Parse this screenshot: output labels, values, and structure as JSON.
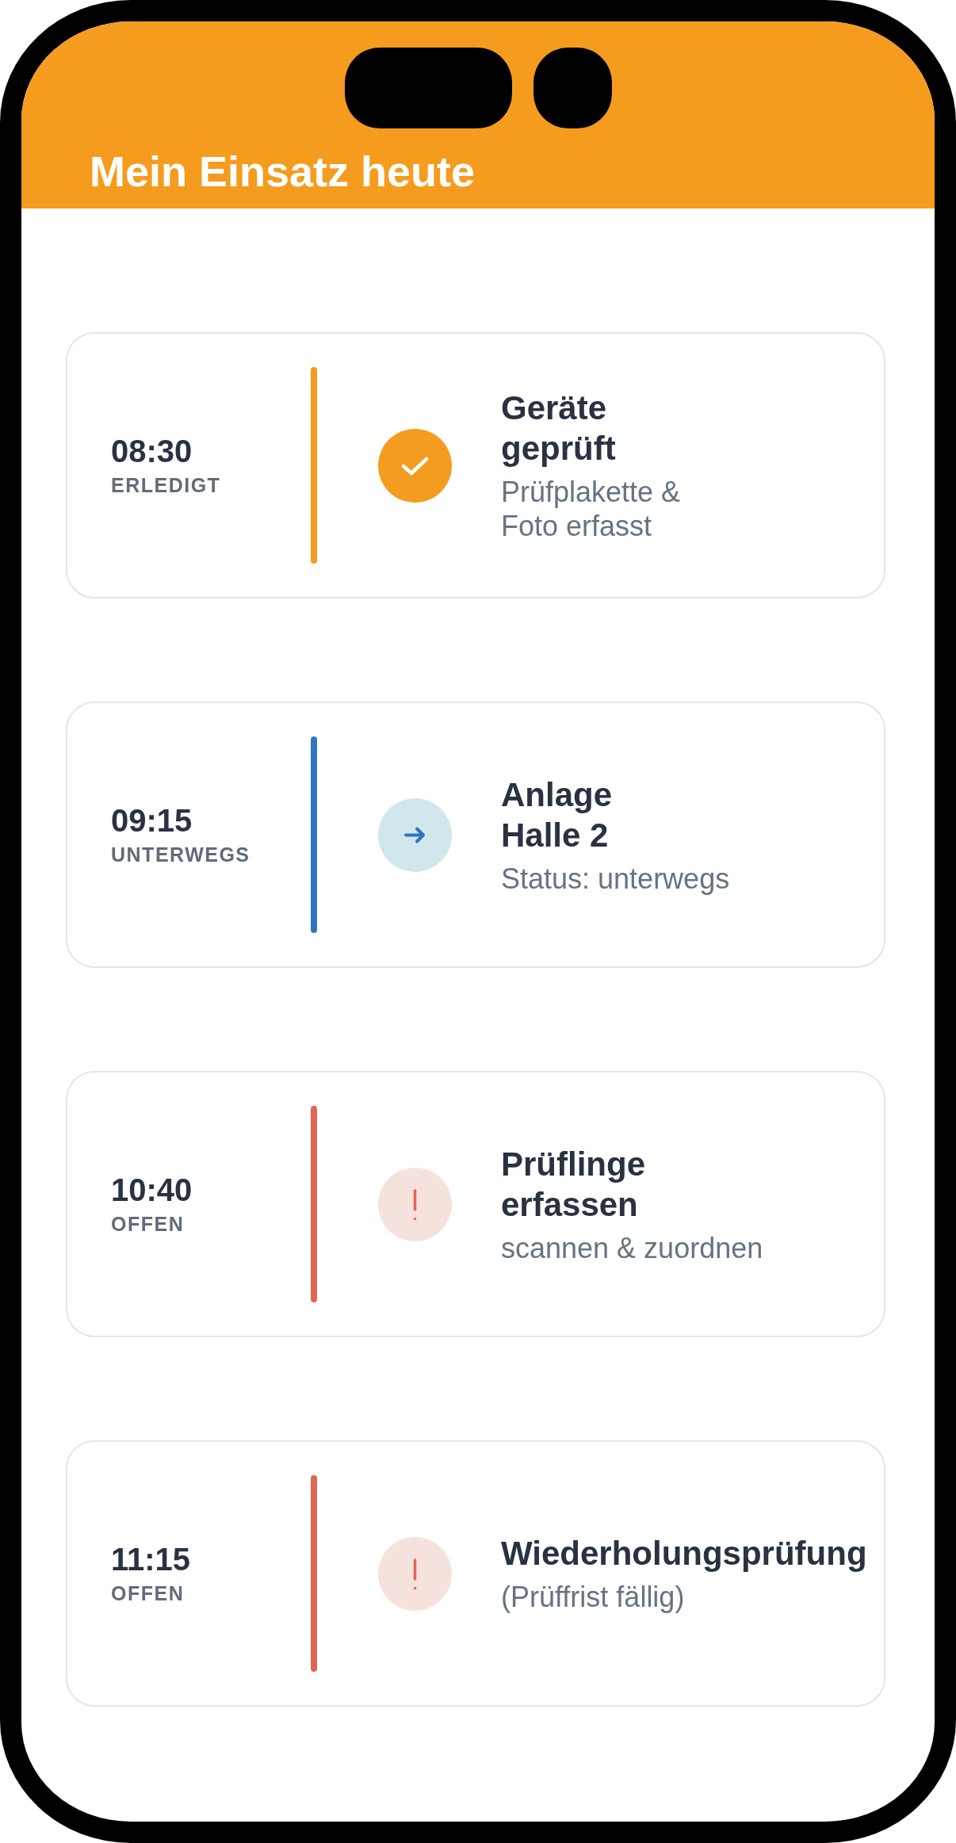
{
  "header": {
    "title": "Mein Einsatz heute"
  },
  "tasks": [
    {
      "time": "08:30",
      "status": "ERLEDIGT",
      "kind": "done",
      "color": "#f39c1f",
      "title": "Geräte\ngeprüft",
      "subtitle": "Prüfplakette &\nFoto erfasst"
    },
    {
      "time": "09:15",
      "status": "UNTERWEGS",
      "kind": "en_route",
      "color": "#2f76c0",
      "title": "Anlage\nHalle 2",
      "subtitle": "Status: unterwegs"
    },
    {
      "time": "10:40",
      "status": "OFFEN",
      "kind": "open",
      "color": "#e06656",
      "title": "Prüflinge\nerfassen",
      "subtitle": "scannen & zuordnen"
    },
    {
      "time": "11:15",
      "status": "OFFEN",
      "kind": "open",
      "color": "#e06656",
      "title": "Wiederholungsprüfung",
      "subtitle": "(Prüffrist fällig)"
    }
  ]
}
